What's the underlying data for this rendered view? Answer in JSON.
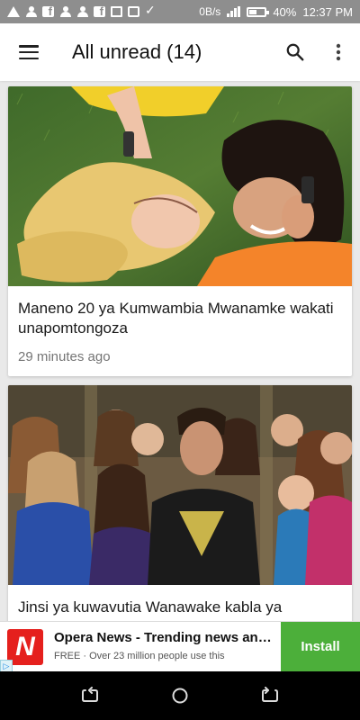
{
  "status_bar": {
    "speed": "0B/s",
    "battery": "40%",
    "time": "12:37 PM",
    "icons": [
      "warning-icon",
      "person-icon",
      "facebook-icon",
      "person-icon",
      "person-icon",
      "facebook-icon",
      "mail-icon",
      "image-icon",
      "check-icon"
    ]
  },
  "app_bar": {
    "title": "All unread (14)",
    "menu_icon": "hamburger-icon",
    "search_icon": "search-icon",
    "more_icon": "more-vert-icon"
  },
  "articles": [
    {
      "title": "Maneno 20 ya Kumwambia Mwanamke wakati unapomtongoza",
      "time": "29 minutes ago"
    },
    {
      "title": "Jinsi ya kuwavutia Wanawake kabla ya",
      "time": ""
    }
  ],
  "ad": {
    "title": "Opera News - Trending news and ...",
    "subtitle": "FREE · Over 23 million people use this",
    "button": "Install",
    "logo_letter": "N",
    "choices_label": "▷"
  },
  "colors": {
    "status_bar": "#8e8e8e",
    "install_button": "#4caf3a",
    "ad_logo": "#e5201d",
    "background": "#e9e9e9"
  }
}
